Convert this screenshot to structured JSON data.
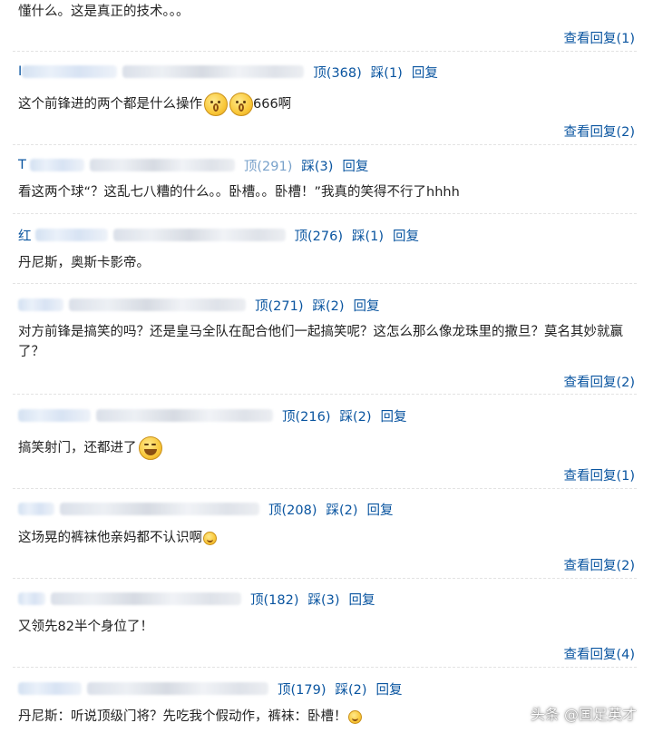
{
  "comments": [
    {
      "content": "懂什么。这是真正的技术。。。",
      "view_replies": "查看回复(1)"
    },
    {
      "meta_prefix": "I",
      "up": "顶(368)",
      "down": "踩(1)",
      "reply": "回复",
      "content": "这个前锋进的两个都是什么操作",
      "content_suffix": "666啊",
      "emojis": [
        "wow-face-icon",
        "wow-face-icon"
      ],
      "view_replies": "查看回复(2)"
    },
    {
      "meta_prefix": "T",
      "up": "顶(291)",
      "down": "踩(3)",
      "reply": "回复",
      "content": "看这两个球“？这乱七八糟的什么。。卧槽。。卧槽！”我真的笑得不行了hhhh"
    },
    {
      "meta_prefix": "红",
      "up": "顶(276)",
      "down": "踩(1)",
      "reply": "回复",
      "content": "丹尼斯，奥斯卡影帝。"
    },
    {
      "meta_prefix": "",
      "up": "顶(271)",
      "down": "踩(2)",
      "reply": "回复",
      "content": "对方前锋是搞笑的吗？还是皇马全队在配合他们一起搞笑呢？这怎么那么像龙珠里的撒旦？莫名其妙就赢了？",
      "view_replies": "查看回复(2)"
    },
    {
      "meta_prefix": "",
      "up": "顶(216)",
      "down": "踩(2)",
      "reply": "回复",
      "content": "搞笑射门，还都进了",
      "emojis": [
        "laughing-face-icon"
      ],
      "view_replies": "查看回复(1)"
    },
    {
      "meta_prefix": "",
      "up": "顶(208)",
      "down": "踩(2)",
      "reply": "回复",
      "content": "这场晃的裤袜他亲妈都不认识啊",
      "emojis": [
        "grin-face-icon"
      ],
      "view_replies": "查看回复(2)"
    },
    {
      "meta_prefix": "",
      "up": "顶(182)",
      "down": "踩(3)",
      "reply": "回复",
      "content": "又领先82半个身位了！",
      "view_replies": "查看回复(4)"
    },
    {
      "meta_prefix": "",
      "up": "顶(179)",
      "down": "踩(2)",
      "reply": "回复",
      "content": "丹尼斯：听说顶级门将？先吃我个假动作，裤袜：卧槽！",
      "emojis": [
        "grin-face-icon"
      ]
    }
  ],
  "watermark": "头条 @国足英才",
  "colors": {
    "link": "#0a55a0",
    "text": "#222222",
    "separator": "#e3e3e3"
  }
}
